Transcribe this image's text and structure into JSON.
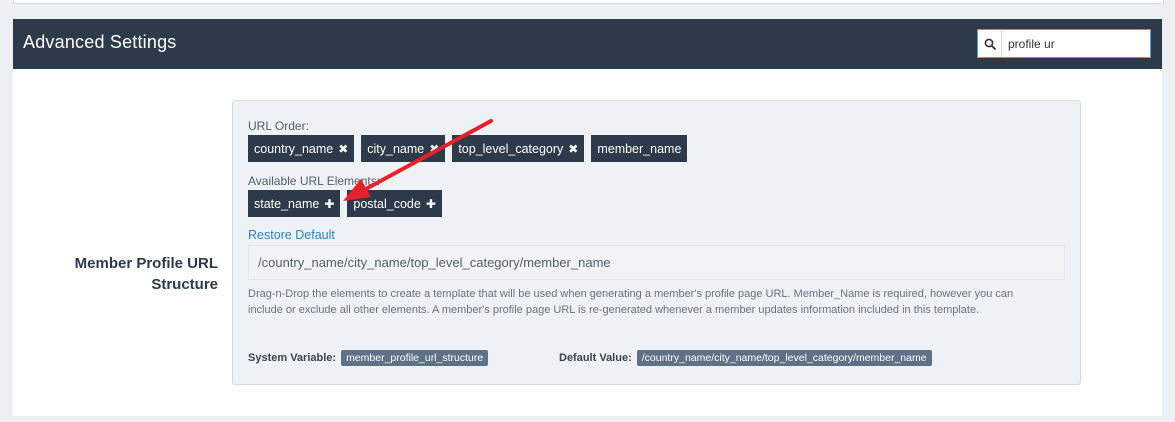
{
  "card": {
    "title": "Advanced Settings",
    "search": {
      "value": "profile ur",
      "icon": "search-icon"
    }
  },
  "field": {
    "label": "Member Profile URL Structure",
    "url_order_label": "URL Order:",
    "url_order": [
      {
        "label": "country_name",
        "icon": "remove-icon"
      },
      {
        "label": "city_name",
        "icon": "remove-icon"
      },
      {
        "label": "top_level_category",
        "icon": "remove-icon"
      },
      {
        "label": "member_name"
      }
    ],
    "available_label": "Available URL Elements:",
    "available": [
      {
        "label": "state_name",
        "icon": "add-icon"
      },
      {
        "label": "postal_code",
        "icon": "add-icon"
      }
    ],
    "restore_label": "Restore Default",
    "preview": "/country_name/city_name/top_level_category/member_name",
    "help": "Drag-n-Drop the elements to create a template that will be used when generating a member's profile page URL. Member_Name is required, however you can include or exclude all other elements. A member's profile page URL is re-generated whenever a member updates information included in this template.",
    "system_variable_label": "System Variable:",
    "system_variable": "member_profile_url_structure",
    "default_value_label": "Default Value:",
    "default_value": "/country_name/city_name/top_level_category/member_name"
  },
  "colors": {
    "header_bg": "#2c3a4a",
    "chip_bg": "#2c3a4a",
    "link": "#2f80c8",
    "annotation_arrow": "#e8202a"
  }
}
